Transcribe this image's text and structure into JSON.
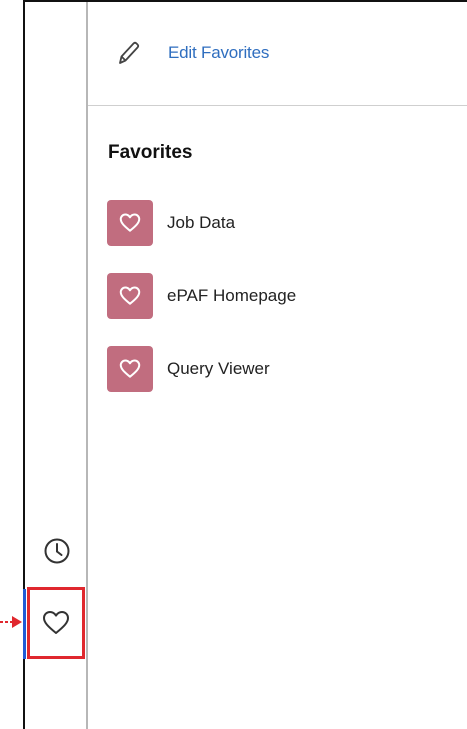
{
  "header": {
    "edit_label": "Edit Favorites",
    "edit_icon": "pencil-icon"
  },
  "favorites": {
    "title": "Favorites",
    "tile_color": "#c16d7f",
    "items": [
      {
        "label": "Job Data",
        "icon": "heart-icon"
      },
      {
        "label": "ePAF Homepage",
        "icon": "heart-icon"
      },
      {
        "label": "Query Viewer",
        "icon": "heart-icon"
      }
    ]
  },
  "rail": {
    "buttons": [
      {
        "name": "recently-visited",
        "icon": "clock-icon"
      },
      {
        "name": "favorites",
        "icon": "heart-outline-icon",
        "active": true
      }
    ],
    "highlight_color": "#e0282e",
    "active_bar_color": "#1f5bd6",
    "annotation_arrow_color": "#e0282e"
  },
  "colors": {
    "link": "#2f6ebf",
    "text": "#222222"
  }
}
